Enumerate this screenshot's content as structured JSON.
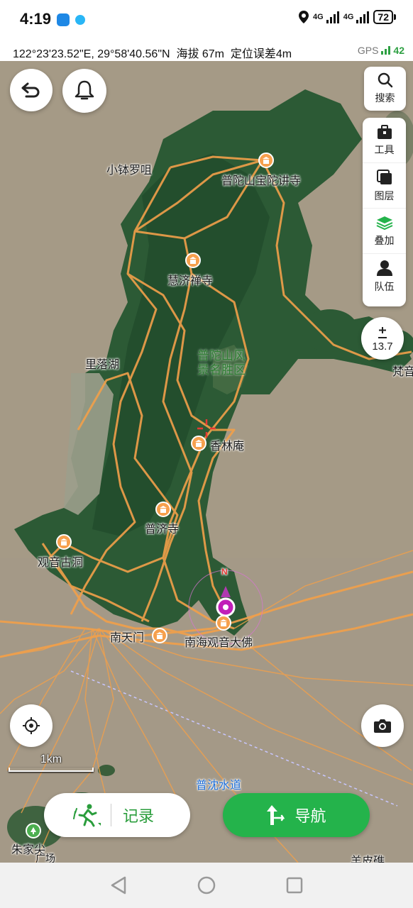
{
  "status_bar": {
    "time": "4:19",
    "network_1": "4G",
    "network_2": "4G",
    "battery": "72"
  },
  "coord_bar": {
    "coordinates": "122°23'23.52\"E, 29°58'40.56\"N",
    "altitude": "海拔 67m",
    "accuracy": "定位误差4m",
    "gps_label": "GPS",
    "gps_value": "42"
  },
  "map": {
    "labels": {
      "xiaobo": "小钵罗咀",
      "baotuo": "普陀山宝陀讲寺",
      "huiji": "慧济禅寺",
      "liluohu": "里落湖",
      "scenic": "普陀山风景名胜区",
      "xianglin": "香林庵",
      "puji": "普济寺",
      "guanyin_cave": "观音古洞",
      "nantianmen": "南天门",
      "big_buddha": "南海观音大佛",
      "waterway": "普沈水道",
      "fan": "梵音",
      "zhujia": "朱家尖",
      "yangpi": "羊皮礁",
      "guangchang": "广场",
      "compass": "N"
    },
    "scale_label": "1km",
    "zoom_level": "13.7"
  },
  "controls": {
    "search": "搜索",
    "tools": "工具",
    "layers": "图层",
    "overlay": "叠加",
    "team": "队伍",
    "record": "记录",
    "navigate": "导航"
  },
  "colors": {
    "accent_green": "#24b34b",
    "track_orange": "#f2a04a",
    "poi_orange": "#f6a04d",
    "location_magenta": "#c11fb8"
  }
}
